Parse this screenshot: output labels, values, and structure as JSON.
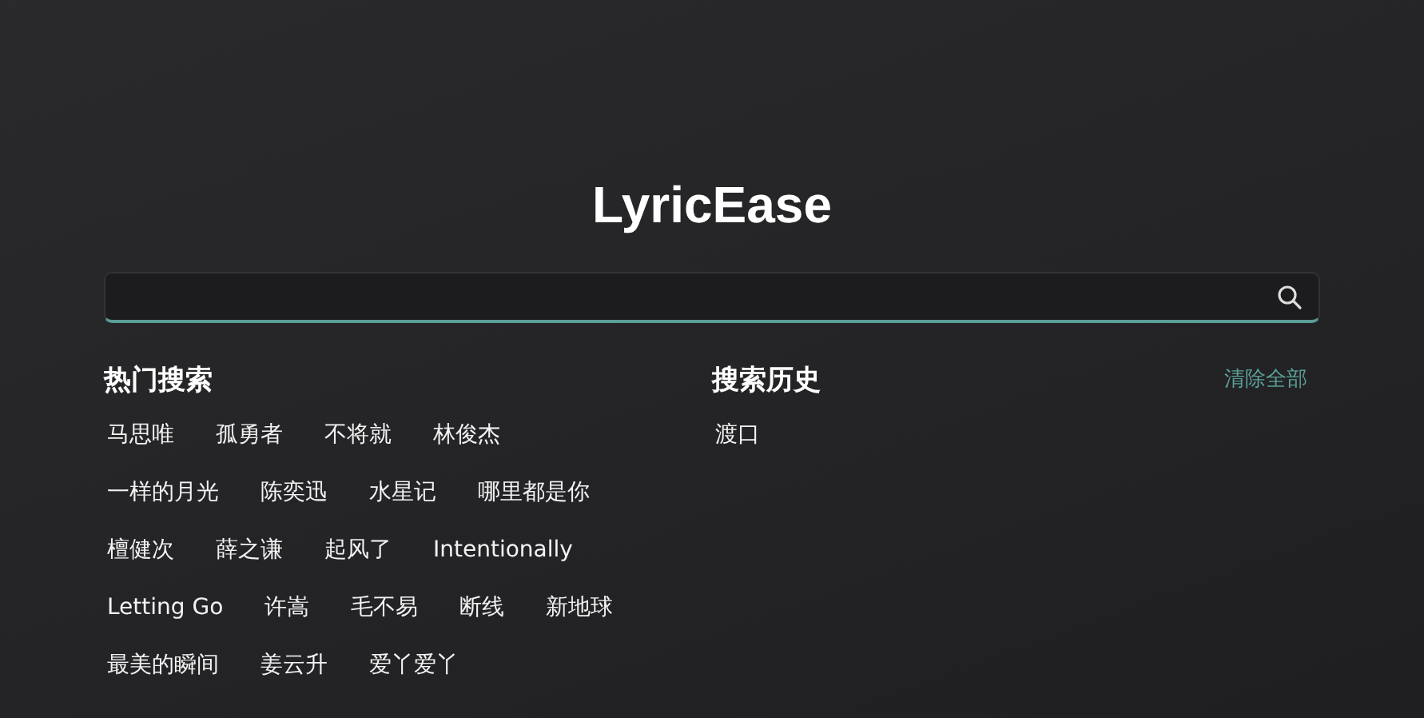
{
  "app_title": "LyricEase",
  "hot": {
    "title": "热门搜索",
    "rows": [
      [
        "马思唯",
        "孤勇者",
        "不将就",
        "林俊杰"
      ],
      [
        "一样的月光",
        "陈奕迅",
        "水星记",
        "哪里都是你"
      ],
      [
        "檀健次",
        "薛之谦",
        "起风了",
        "Intentionally"
      ],
      [
        "Letting Go",
        "许嵩",
        "毛不易",
        "断线",
        "新地球"
      ],
      [
        "最美的瞬间",
        "姜云升",
        "爱丫爱丫"
      ]
    ]
  },
  "history": {
    "title": "搜索历史",
    "clear_label": "清除全部",
    "items": [
      "渡口"
    ]
  }
}
